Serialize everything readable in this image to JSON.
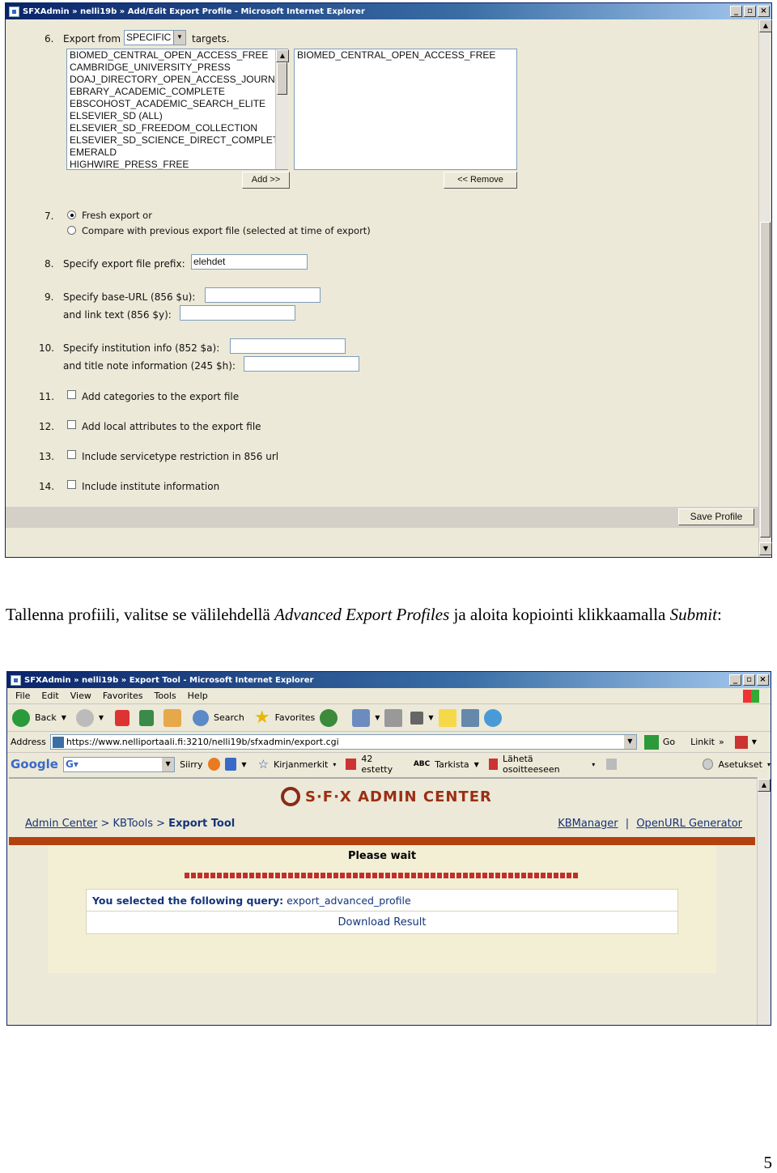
{
  "window1": {
    "title": "SFXAdmin » nelli19b » Add/Edit Export Profile - Microsoft Internet Explorer",
    "buttons": [
      "_",
      "▫",
      "×"
    ]
  },
  "form": {
    "q6": {
      "num": "6.",
      "label_pre": "Export from",
      "select_value": "SPECIFIC",
      "label_post": "targets."
    },
    "available_targets": [
      "BIOMED_CENTRAL_OPEN_ACCESS_FREE",
      "CAMBRIDGE_UNIVERSITY_PRESS",
      "DOAJ_DIRECTORY_OPEN_ACCESS_JOURNA",
      "EBRARY_ACADEMIC_COMPLETE",
      "EBSCOHOST_ACADEMIC_SEARCH_ELITE",
      "ELSEVIER_SD (ALL)",
      "ELSEVIER_SD_FREEDOM_COLLECTION",
      "ELSEVIER_SD_SCIENCE_DIRECT_COMPLET",
      "EMERALD",
      "HIGHWIRE_PRESS_FREE"
    ],
    "selected_targets": [
      "BIOMED_CENTRAL_OPEN_ACCESS_FREE"
    ],
    "add_label": "Add >>",
    "remove_label": "<< Remove",
    "q7": {
      "num": "7.",
      "opt1": "Fresh export or",
      "opt2": "Compare with previous export file (selected at time of export)"
    },
    "q8": {
      "num": "8.",
      "label": "Specify export file prefix:",
      "value": "elehdet"
    },
    "q9": {
      "num": "9.",
      "label1": "Specify base-URL (856 $u):",
      "label2": "and link text (856 $y):"
    },
    "q10": {
      "num": "10.",
      "label1": "Specify institution info (852 $a):",
      "label2": "and title note information (245 $h):"
    },
    "q11": {
      "num": "11.",
      "label": "Add categories to the export file"
    },
    "q12": {
      "num": "12.",
      "label": "Add local attributes to the export file"
    },
    "q13": {
      "num": "13.",
      "label": "Include servicetype restriction in 856 url"
    },
    "q14": {
      "num": "14.",
      "label": "Include institute information"
    },
    "save_label": "Save Profile"
  },
  "caption": {
    "t1": "Tallenna profiili, valitse se välilehdellä ",
    "em1": "Advanced Export Profiles",
    "t2": " ja aloita kopiointi klikkaamalla ",
    "em2": "Submit",
    "t3": ":"
  },
  "window2": {
    "title": "SFXAdmin » nelli19b » Export Tool - Microsoft Internet Explorer",
    "menu": [
      "File",
      "Edit",
      "View",
      "Favorites",
      "Tools",
      "Help"
    ],
    "toolbar": {
      "back": "Back",
      "search": "Search",
      "favorites": "Favorites"
    },
    "address_label": "Address",
    "address_value": "https://www.nelliportaali.fi:3210/nelli19b/sfxadmin/export.cgi",
    "go_label": "Go",
    "links_label": "Linkit",
    "google": {
      "logo": "Google",
      "siirry": "Siirry",
      "kirjanmerkit": "Kirjanmerkit",
      "estetty": "42 estetty",
      "tarkista": "Tarkista",
      "laheta": "Lähetä osoitteeseen",
      "asetukset": "Asetukset"
    },
    "brand": "S·F·X ADMIN CENTER",
    "breadcrumb": {
      "admin_center": "Admin Center",
      "sep1": " > ",
      "kbtools": "KBTools",
      "sep2": " > ",
      "export_tool": "Export Tool"
    },
    "links": {
      "kbmanager": "KBManager",
      "sep": "|",
      "openurl": "OpenURL Generator"
    },
    "please_wait": "Please wait",
    "query_label": "You selected the following query:",
    "query_value": "export_advanced_profile",
    "download_label": "Download Result"
  },
  "page_number": "5",
  "colors": {
    "accent_bar": "#b2410f",
    "panel": "#f2efd5",
    "link": "#14347a"
  }
}
